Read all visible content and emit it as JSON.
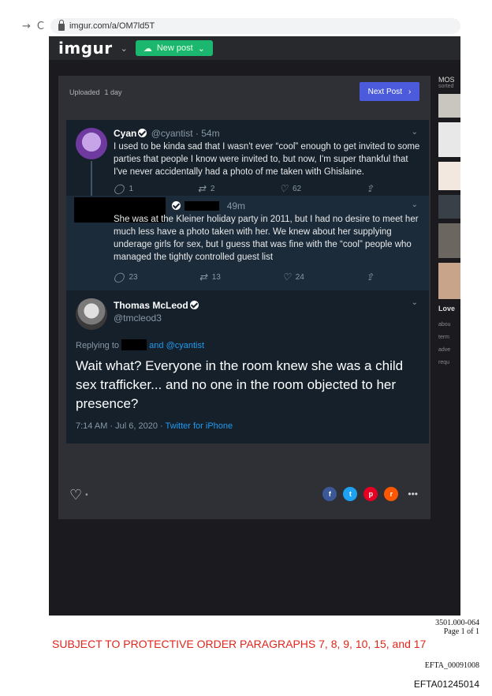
{
  "browser": {
    "url": "imgur.com/a/OM7ld5T",
    "back_icon": "→",
    "reload_icon": "C"
  },
  "imgur": {
    "logo": "imgur",
    "new_post": "New post"
  },
  "post": {
    "uploaded_label": "Uploaded",
    "uploaded_time": "1 day",
    "next_post": "Next Post"
  },
  "tweets": {
    "cyan": {
      "name": "Cyan",
      "handle": "@cyantist · 54m",
      "text": "I used to be kinda sad that I wasn't ever “cool” enough to get invited to some parties that people I know were invited to, but now, I'm super thankful that I've never accidentally had a photo of me taken with Ghislaine.",
      "replies": "1",
      "retweets": "2",
      "likes": "62"
    },
    "redacted": {
      "time": "49m",
      "text": "She was at the Kleiner holiday party in 2011, but I had no desire to meet her much less have a photo taken with her. We knew about her supplying underage girls for sex, but I guess that was fine with the “cool” people who managed the tightly controlled guest list",
      "replies": "23",
      "retweets": "13",
      "likes": "24"
    },
    "thomas": {
      "name": "Thomas McLeod",
      "handle": "@tmcleod3",
      "reply_prefix": "Replying to",
      "reply_suffix": "and @cyantist",
      "text": "Wait what? Everyone in the room knew she was a child sex trafficker... and no one in the room objected to her presence?",
      "time": "7:14 AM · Jul 6, 2020 · ",
      "source": "Twitter for iPhone"
    }
  },
  "share": {
    "facebook": "f",
    "twitter": "t",
    "pinterest": "p",
    "reddit": "r",
    "more": "•••"
  },
  "sidebar": {
    "title": "MOS",
    "subtitle": "sorted",
    "love": "Love",
    "links": [
      "abou",
      "term",
      "adve",
      "requ"
    ]
  },
  "document": {
    "ref": "3501.000-064",
    "page": "Page 1 of 1",
    "protective": "SUBJECT TO PROTECTIVE ORDER PARAGRAPHS 7, 8, 9, 10, 15, and 17",
    "bates1": "EFTA_00091008",
    "bates2": "EFTA01245014"
  }
}
